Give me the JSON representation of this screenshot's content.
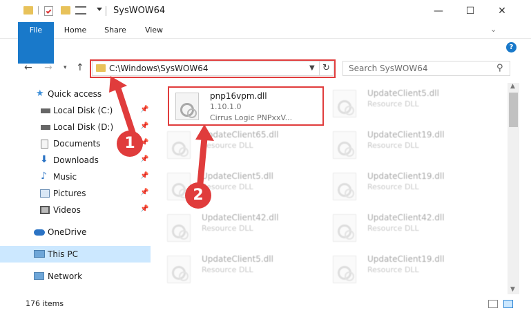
{
  "window": {
    "title": "SysWOW64",
    "minimize": "—",
    "maximize": "☐",
    "close": "✕"
  },
  "ribbon": {
    "tabs": [
      "File",
      "Home",
      "Share",
      "View"
    ],
    "help": "?"
  },
  "address": {
    "path": "C:\\Windows\\SysWOW64",
    "refresh": "↻"
  },
  "search": {
    "placeholder": "Search SysWOW64"
  },
  "sidebar": {
    "items": [
      {
        "label": "Quick access",
        "icon": "star-icon"
      },
      {
        "label": "Local Disk (C:)",
        "icon": "drive-icon"
      },
      {
        "label": "Local Disk (D:)",
        "icon": "drive-icon"
      },
      {
        "label": "Documents",
        "icon": "documents-icon"
      },
      {
        "label": "Downloads",
        "icon": "download-icon"
      },
      {
        "label": "Music",
        "icon": "music-icon"
      },
      {
        "label": "Pictures",
        "icon": "pictures-icon"
      },
      {
        "label": "Videos",
        "icon": "videos-icon"
      },
      {
        "label": "OneDrive",
        "icon": "cloud-icon"
      },
      {
        "label": "This PC",
        "icon": "computer-icon"
      },
      {
        "label": "Network",
        "icon": "network-icon"
      }
    ]
  },
  "files": [
    {
      "name": "pnp16vpm.dll",
      "version": "1.10.1.0",
      "desc": "Cirrus Logic PNPxxV..."
    },
    {
      "name": "UpdateClient5.dll",
      "desc": "Resource DLL"
    },
    {
      "name": "UpdateClient65.dll",
      "desc": "Resource DLL"
    },
    {
      "name": "UpdateClient19.dll",
      "desc": "Resource DLL"
    },
    {
      "name": "UpdateClient5.dll",
      "desc": "Resource DLL"
    },
    {
      "name": "UpdateClient19.dll",
      "desc": "Resource DLL"
    },
    {
      "name": "UpdateClient42.dll",
      "desc": "Resource DLL"
    },
    {
      "name": "UpdateClient42.dll",
      "desc": "Resource DLL"
    },
    {
      "name": "UpdateClient5.dll",
      "desc": "Resource DLL"
    },
    {
      "name": "UpdateClient19.dll",
      "desc": "Resource DLL"
    }
  ],
  "status": {
    "count": "176 items"
  },
  "markers": [
    "1",
    "2"
  ],
  "colors": {
    "accent": "#1979ca",
    "highlight": "#e03c3c",
    "selection": "#cce8ff"
  }
}
